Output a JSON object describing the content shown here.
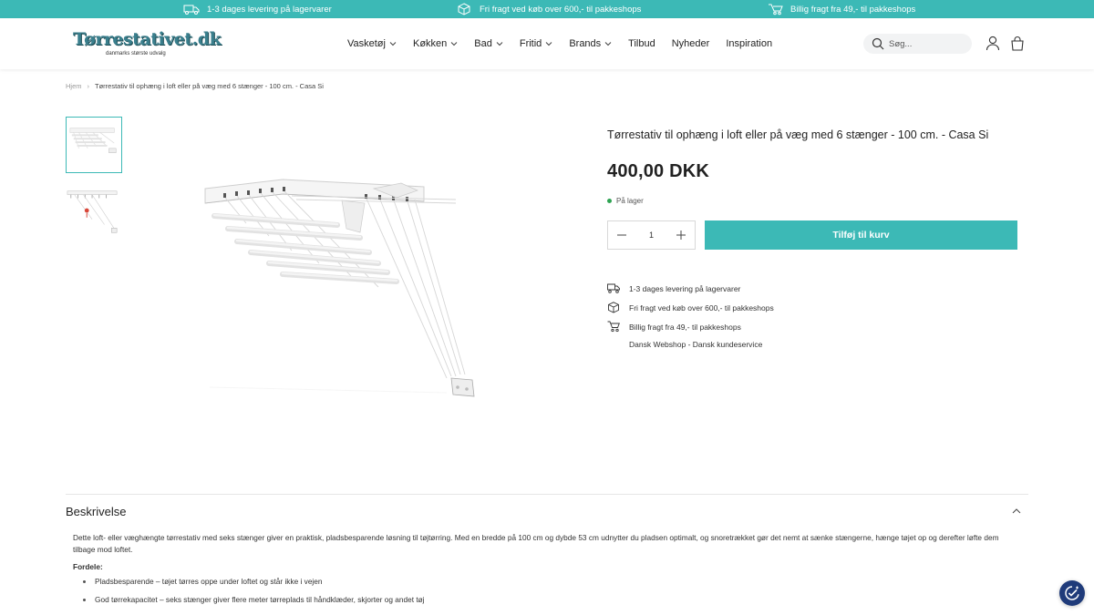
{
  "topbar": {
    "usps": [
      {
        "icon": "truck-icon",
        "text": "1-3 dages levering på lagervarer"
      },
      {
        "icon": "box-icon",
        "text": "Fri fragt ved køb over 600,- til pakkeshops"
      },
      {
        "icon": "truck-fast-icon",
        "text": "Billig fragt fra 49,- til pakkeshops"
      }
    ],
    "bg_color": "#3cb9b6"
  },
  "header": {
    "logo": {
      "brand": "Tørrestativet.dk",
      "tagline": "danmarks største udvalg"
    },
    "nav": [
      {
        "label": "Vasketøj",
        "has_dropdown": true
      },
      {
        "label": "Køkken",
        "has_dropdown": true
      },
      {
        "label": "Bad",
        "has_dropdown": true
      },
      {
        "label": "Fritid",
        "has_dropdown": true
      },
      {
        "label": "Brands",
        "has_dropdown": true
      },
      {
        "label": "Tilbud",
        "has_dropdown": false
      },
      {
        "label": "Nyheder",
        "has_dropdown": false
      },
      {
        "label": "Inspiration",
        "has_dropdown": false
      }
    ],
    "search": {
      "placeholder": "Søg..."
    },
    "icons": [
      "account-icon",
      "cart-icon"
    ]
  },
  "breadcrumb": {
    "home": "Hjem",
    "separator": "›",
    "current": "Tørrestativ til ophæng i loft eller på væg med 6 stænger - 100 cm. - Casa Si"
  },
  "product": {
    "title": "Tørrestativ til ophæng i loft eller på væg med 6 stænger - 100 cm. - Casa Si",
    "price": "400,00 DKK",
    "stock": "På lager",
    "quantity": "1",
    "add_to_cart": "Tilføj til kurv",
    "usps": [
      {
        "icon": "truck-icon",
        "text": "1-3 dages levering på lagervarer"
      },
      {
        "icon": "box-icon",
        "text": "Fri fragt ved køb over 600,- til pakkeshops"
      },
      {
        "icon": "truck-fast-icon",
        "text": "Billig fragt fra 49,- til pakkeshops"
      },
      {
        "icon": "",
        "text": "Dansk Webshop - Dansk kundeservice"
      }
    ]
  },
  "description": {
    "heading": "Beskrivelse",
    "intro": "Dette loft- eller væghængte tørrestativ med seks stænger giver en praktisk, pladsbesparende løsning til tøjtørring. Med en bredde på 100 cm og dybde 53 cm udnytter du pladsen optimalt, og snoretrækket gør det nemt at sænke stængerne, hænge tøjet op og derefter løfte dem tilbage mod loftet.",
    "benefits_label": "Fordele:",
    "benefits": [
      "Pladsbesparende – tøjet tørres oppe under loftet og står ikke i vejen",
      "God tørrekapacitet – seks stænger giver flere meter tørreplads til håndklæder, skjorter og andet tøj"
    ]
  },
  "colors": {
    "accent": "#3cb9b6",
    "in_stock": "#2ea352",
    "cookie_badge": "#1f3b7a"
  }
}
